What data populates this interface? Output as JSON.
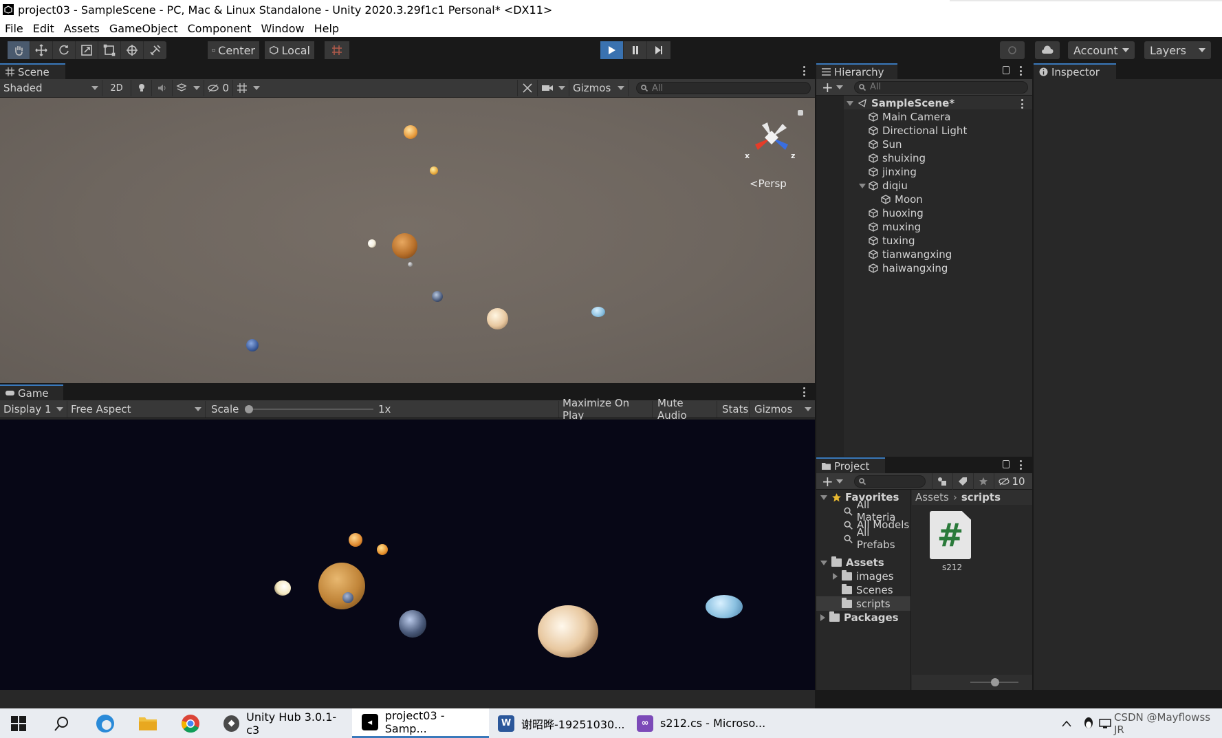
{
  "window": {
    "title": "project03 - SampleScene - PC, Mac & Linux Standalone - Unity 2020.3.29f1c1 Personal* <DX11>"
  },
  "menu": [
    "File",
    "Edit",
    "Assets",
    "GameObject",
    "Component",
    "Window",
    "Help"
  ],
  "toolbar": {
    "pivot_label": "Center",
    "space_label": "Local",
    "account_label": "Account",
    "layers_label": "Layers"
  },
  "scene": {
    "tab_label": "Scene",
    "shading_mode": "Shaded",
    "mode_2d": "2D",
    "hidden_count": "0",
    "gizmos_label": "Gizmos",
    "search_placeholder": "All",
    "persp_label": "<Persp",
    "axis_x": "x",
    "axis_z": "z"
  },
  "game": {
    "tab_label": "Game",
    "display": "Display 1",
    "aspect": "Free Aspect",
    "scale_label": "Scale",
    "scale_value": "1x",
    "maximize_label": "Maximize On Play",
    "mute_label": "Mute Audio",
    "stats_label": "Stats",
    "gizmos_label": "Gizmos"
  },
  "hierarchy": {
    "tab_label": "Hierarchy",
    "search_placeholder": "All",
    "scene_name": "SampleScene*",
    "items": [
      "Main Camera",
      "Directional Light",
      "Sun",
      "shuixing",
      "jinxing",
      "diqiu",
      "Moon",
      "huoxing",
      "muxing",
      "tuxing",
      "tianwangxing",
      "haiwangxing"
    ]
  },
  "inspector": {
    "tab_label": "Inspector"
  },
  "project": {
    "tab_label": "Project",
    "hidden_count": "10",
    "favorites_label": "Favorites",
    "favorites": [
      "All Materia",
      "All Models",
      "All Prefabs"
    ],
    "assets_label": "Assets",
    "asset_folders": [
      "images",
      "Scenes",
      "scripts"
    ],
    "packages_label": "Packages",
    "breadcrumb_root": "Assets",
    "breadcrumb_current": "scripts",
    "file_name": "s212",
    "file_glyph": "#"
  },
  "taskbar": {
    "items": [
      "Unity Hub 3.0.1-c3",
      "project03 - Samp...",
      "谢昭晔-19251030...",
      "s212.cs - Microso..."
    ],
    "tray_text": "CSDN @Mayflowss JR"
  }
}
